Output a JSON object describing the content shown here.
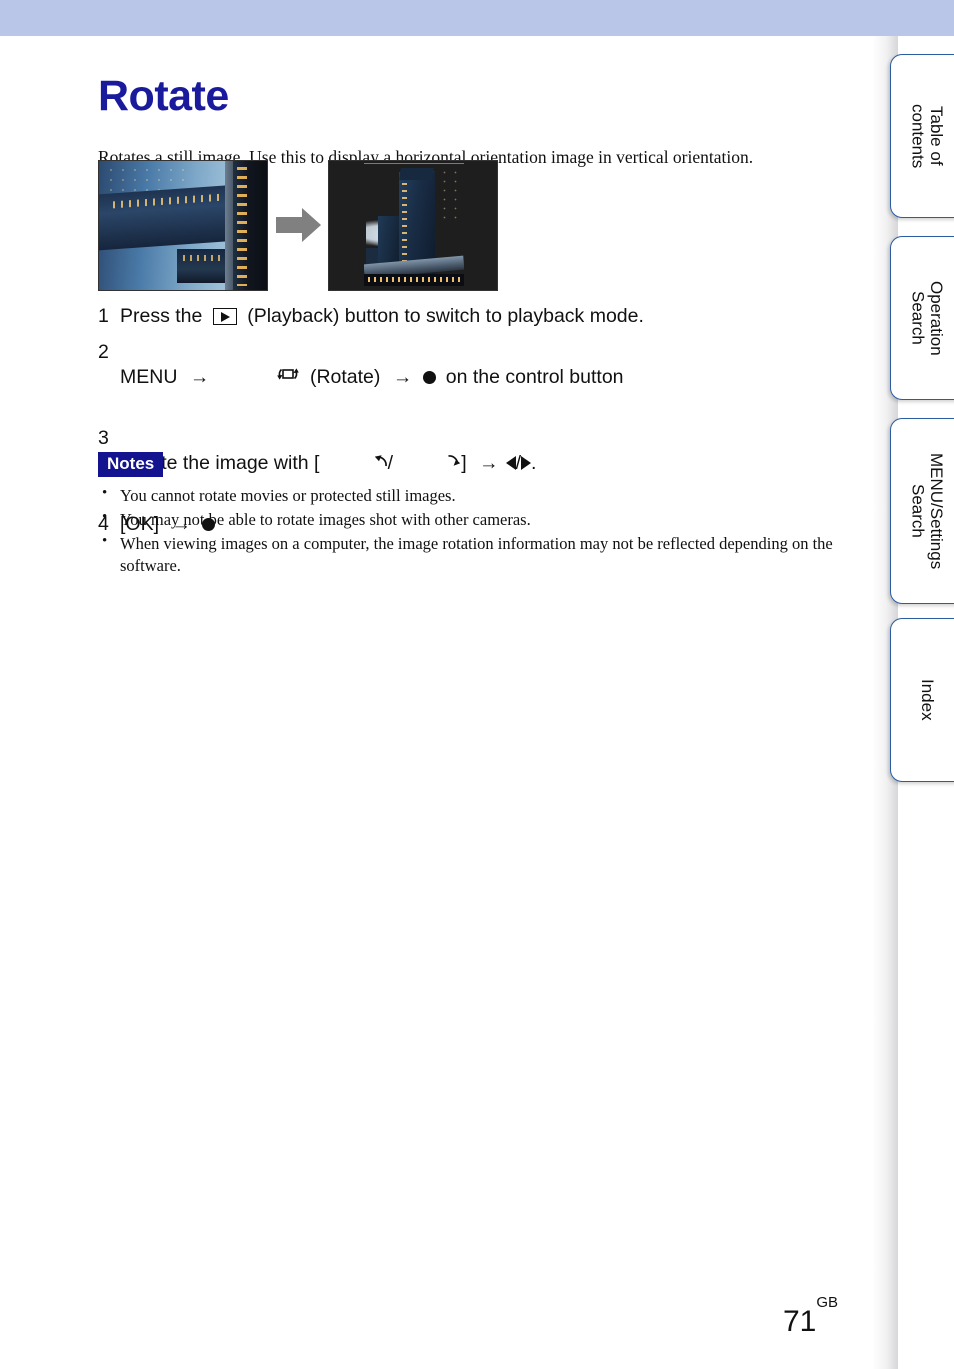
{
  "header": {
    "band_color": "#b9c6e8"
  },
  "page": {
    "title": "Rotate",
    "intro": "Rotates a still image. Use this to display a horizontal orientation image in vertical orientation.",
    "number": "71",
    "number_suffix": "GB",
    "title_color": "#1a1a9c"
  },
  "figure": {
    "before_alt": "still image of a skyscraper shown in horizontal (rotated) orientation",
    "after_alt": "same skyscraper image displayed upright in vertical orientation",
    "arrow_color": "#808080"
  },
  "steps": [
    {
      "num": "1",
      "parts": [
        {
          "type": "text",
          "value": "Press the "
        },
        {
          "type": "icon",
          "icon": "playback-icon"
        },
        {
          "type": "text",
          "value": " (Playback) button to switch to playback mode."
        }
      ],
      "plain": "Press the (Playback) button to switch to playback mode."
    },
    {
      "num": "2",
      "parts": [
        {
          "type": "text",
          "value": "MENU "
        },
        {
          "type": "icon",
          "icon": "arrow-right-icon"
        },
        {
          "type": "icon",
          "icon": "rotate-icon"
        },
        {
          "type": "text",
          "value": " (Rotate) "
        },
        {
          "type": "icon",
          "icon": "arrow-right-icon"
        },
        {
          "type": "icon",
          "icon": "center-button-icon"
        },
        {
          "type": "text",
          "value": " on the control button"
        }
      ],
      "plain": "MENU → (Rotate) → on the control button"
    },
    {
      "num": "3",
      "parts": [
        {
          "type": "text",
          "value": "Rotate the image with ["
        },
        {
          "type": "icon",
          "icon": "rotate-ccw-icon"
        },
        {
          "type": "text",
          "value": "/"
        },
        {
          "type": "icon",
          "icon": "rotate-cw-icon"
        },
        {
          "type": "text",
          "value": "] "
        },
        {
          "type": "icon",
          "icon": "arrow-right-icon"
        },
        {
          "type": "icon",
          "icon": "triangle-left-icon"
        },
        {
          "type": "text",
          "value": "/"
        },
        {
          "type": "icon",
          "icon": "triangle-right-icon"
        },
        {
          "type": "text",
          "value": "."
        }
      ],
      "plain": "Rotate the image with [ / ] → / ."
    },
    {
      "num": "4",
      "parts": [
        {
          "type": "text",
          "value": "[OK] "
        },
        {
          "type": "icon",
          "icon": "arrow-right-icon"
        },
        {
          "type": "icon",
          "icon": "center-button-icon"
        }
      ],
      "plain": "[OK] →"
    }
  ],
  "step_labels": {
    "s1_num": "1",
    "s1_a": "Press the ",
    "s1_b": " (Playback) button to switch to playback mode.",
    "s2_num": "2",
    "s2_a": "MENU ",
    "s2_arrow": "→",
    "s2_b": " (Rotate) ",
    "s2_c": " on the control button",
    "s3_num": "3",
    "s3_a": "Rotate the image with [",
    "s3_slash": "/",
    "s3_b": "] ",
    "s3_c": ".",
    "s4_num": "4",
    "s4_a": "[OK] "
  },
  "notes": {
    "badge": "Notes",
    "badge_color": "#13128f",
    "items": [
      "You cannot rotate movies or protected still images.",
      "You may not be able to rotate images shot with other cameras.",
      "When viewing images on a computer, the image rotation information may not be reflected depending on the software."
    ]
  },
  "tabs": [
    {
      "label": "Table of\ncontents",
      "id": "table-of-contents"
    },
    {
      "label": "Operation\nSearch",
      "id": "operation-search"
    },
    {
      "label": "MENU/Settings\nSearch",
      "id": "menu-settings-search"
    },
    {
      "label": "Index",
      "id": "index"
    }
  ]
}
